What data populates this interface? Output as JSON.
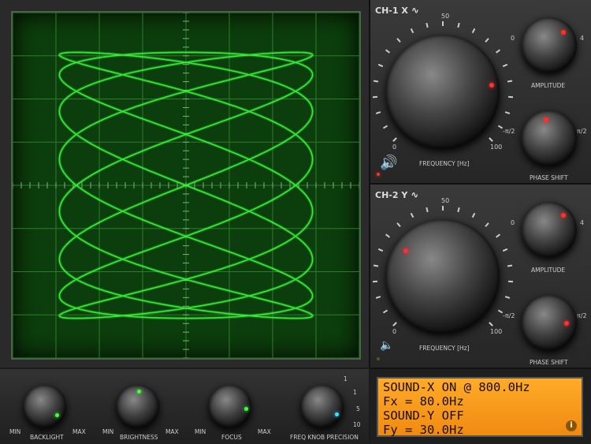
{
  "colors": {
    "trace": "#3dff3d",
    "grid": "#2f7a2f",
    "lcd": "#f59a1a",
    "indicator": "#ff3030"
  },
  "channel_x": {
    "title": "CH-1 X",
    "wave_icon": "sine-wave-icon",
    "frequency": {
      "label": "FREQUENCY [Hz]",
      "min": "0",
      "mid": "50",
      "max": "100"
    },
    "amplitude": {
      "label": "AMPLITUDE",
      "min": "0",
      "max": "4"
    },
    "phase": {
      "label": "PHASE SHIFT",
      "min": "-π/2",
      "max": "π/2"
    },
    "sound_icon": "speaker-on-icon"
  },
  "channel_y": {
    "title": "CH-2 Y",
    "wave_icon": "sine-wave-icon",
    "frequency": {
      "label": "FREQUENCY [Hz]",
      "min": "0",
      "mid": "50",
      "max": "100"
    },
    "amplitude": {
      "label": "AMPLITUDE",
      "min": "0",
      "max": "4"
    },
    "phase": {
      "label": "PHASE SHIFT",
      "min": "-π/2",
      "max": "π/2"
    },
    "sound_icon": "speaker-off-icon"
  },
  "bottom": {
    "backlight": {
      "label": "BACKLIGHT",
      "min": "MIN",
      "max": "MAX"
    },
    "brightness": {
      "label": "BRIGHTNESS",
      "min": "MIN",
      "max": "MAX"
    },
    "focus": {
      "label": "FOCUS",
      "min": "MIN",
      "max": "MAX"
    },
    "precision": {
      "label": "FREQ KNOB PRECISION",
      "steps": [
        "1",
        "1",
        "5",
        "10"
      ]
    }
  },
  "lcd": {
    "line1": "SOUND-X ON @ 800.0Hz",
    "line2": "Fx = 80.0Hz",
    "line3": "SOUND-Y OFF",
    "line4": "Fy = 30.0Hz"
  },
  "signal": {
    "fx": 80.0,
    "fy": 30.0
  }
}
